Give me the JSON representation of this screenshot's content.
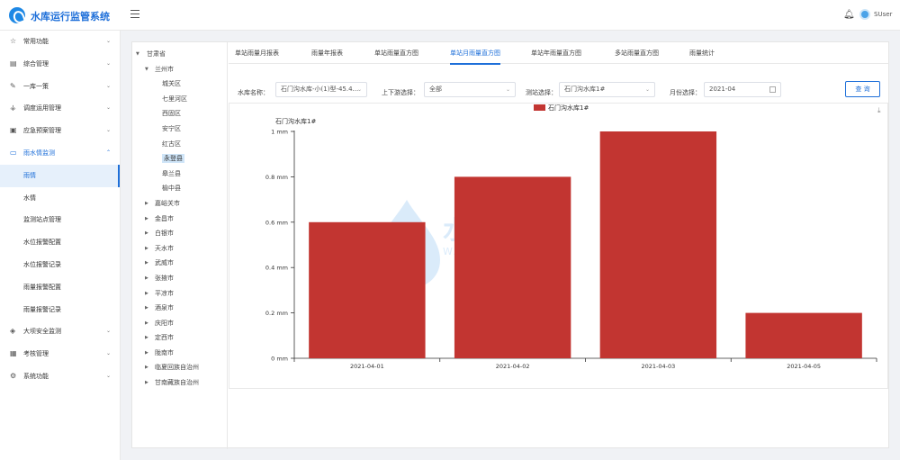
{
  "header": {
    "title": "水库运行监管系统",
    "user": "SUser"
  },
  "sidebar": {
    "items": [
      {
        "label": "常用功能",
        "icon": "star-icon",
        "glyph": "☆",
        "arrow": "⌄"
      },
      {
        "label": "综合管理",
        "icon": "grid-icon",
        "glyph": "▤",
        "arrow": "⌄"
      },
      {
        "label": "一库一策",
        "icon": "edit-icon",
        "glyph": "✎",
        "arrow": "⌄"
      },
      {
        "label": "调度运用管理",
        "icon": "dispatch-icon",
        "glyph": "⚶",
        "arrow": "⌄"
      },
      {
        "label": "应急预案管理",
        "icon": "briefcase-icon",
        "glyph": "▣",
        "arrow": "⌄"
      },
      {
        "label": "雨水情监测",
        "icon": "monitor-icon",
        "glyph": "▭",
        "arrow": "⌃",
        "open": true,
        "children": [
          {
            "label": "雨情",
            "active": true
          },
          {
            "label": "水情"
          },
          {
            "label": "监测站点管理"
          },
          {
            "label": "水位报警配置"
          },
          {
            "label": "水位报警记录"
          },
          {
            "label": "雨量报警配置"
          },
          {
            "label": "雨量报警记录"
          }
        ]
      },
      {
        "label": "大坝安全监测",
        "icon": "dam-icon",
        "glyph": "◈",
        "arrow": "⌄"
      },
      {
        "label": "考核管理",
        "icon": "assess-icon",
        "glyph": "▦",
        "arrow": "⌄"
      },
      {
        "label": "系统功能",
        "icon": "gear-icon",
        "glyph": "⚙",
        "arrow": "⌄"
      }
    ]
  },
  "tree": {
    "root": "甘肃省",
    "city_open": "兰州市",
    "districts": [
      "城关区",
      "七里河区",
      "西固区",
      "安宁区",
      "红古区",
      "永登县",
      "皋兰县",
      "榆中县"
    ],
    "selected": "永登县",
    "cities": [
      "嘉峪关市",
      "金昌市",
      "白银市",
      "天水市",
      "武威市",
      "张掖市",
      "平凉市",
      "酒泉市",
      "庆阳市",
      "定西市",
      "陇南市",
      "临夏回族自治州",
      "甘南藏族自治州"
    ]
  },
  "tabs": [
    {
      "label": "单站雨量月报表"
    },
    {
      "label": "雨量年报表"
    },
    {
      "label": "单站雨量直方图"
    },
    {
      "label": "单站月雨量直方图",
      "active": true
    },
    {
      "label": "单站年雨量直方图"
    },
    {
      "label": "多站雨量直方图"
    },
    {
      "label": "雨量统计"
    }
  ],
  "filters": {
    "reservoir_label": "水库名称：",
    "reservoir_value": "石门沟水库-小(1)型-45.4...",
    "stream_label": "上下游选择：",
    "stream_value": "全部",
    "station_label": "测站选择：",
    "station_value": "石门沟水库1#",
    "month_label": "月份选择：",
    "month_value": "2021-04",
    "query_button": "查 询"
  },
  "watermark": {
    "cn": "水迅通",
    "en": "WATER WAY"
  },
  "colors": {
    "bar": "#c23531",
    "accent": "#1e6fd9"
  },
  "chart_data": {
    "type": "bar",
    "categories": [
      "2021-04-01",
      "2021-04-02",
      "2021-04-03",
      "2021-04-05"
    ],
    "series": [
      {
        "name": "石门沟水库1#",
        "values": [
          0.6,
          0.8,
          1.0,
          0.2
        ]
      }
    ],
    "title": "",
    "ylabel": "石门沟水库1#",
    "ylim": [
      0,
      1
    ],
    "yticks": [
      0,
      0.2,
      0.4,
      0.6,
      0.8,
      1
    ],
    "yunit": "mm",
    "legend": "top-center"
  }
}
